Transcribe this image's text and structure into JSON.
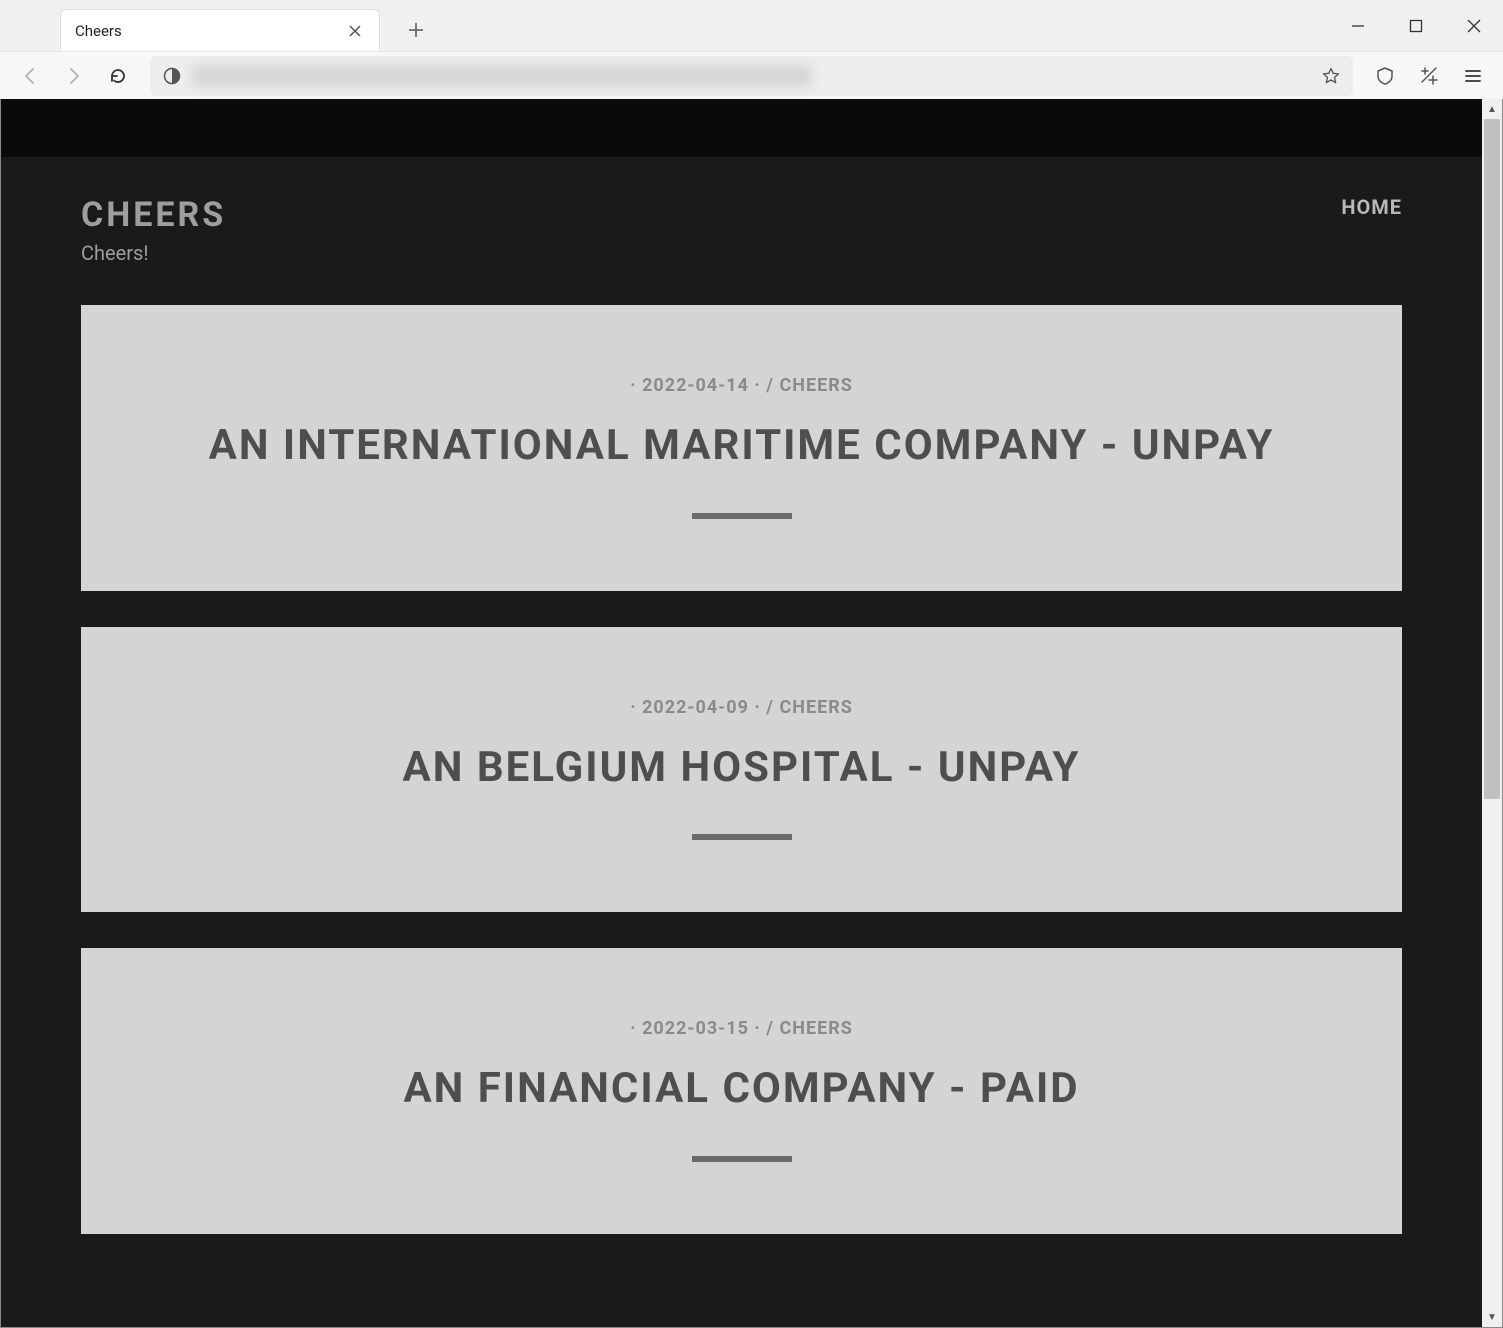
{
  "browser": {
    "tab_title": "Cheers"
  },
  "page": {
    "brand": "CHEERS",
    "tagline": "Cheers!",
    "nav_home": "HOME",
    "posts": [
      {
        "date": "2022-04-14",
        "author": "CHEERS",
        "title": "AN INTERNATIONAL MARITIME COMPANY - UNPAY"
      },
      {
        "date": "2022-04-09",
        "author": "CHEERS",
        "title": "AN BELGIUM HOSPITAL - UNPAY"
      },
      {
        "date": "2022-03-15",
        "author": "CHEERS",
        "title": "AN FINANCIAL COMPANY - PAID"
      }
    ]
  }
}
